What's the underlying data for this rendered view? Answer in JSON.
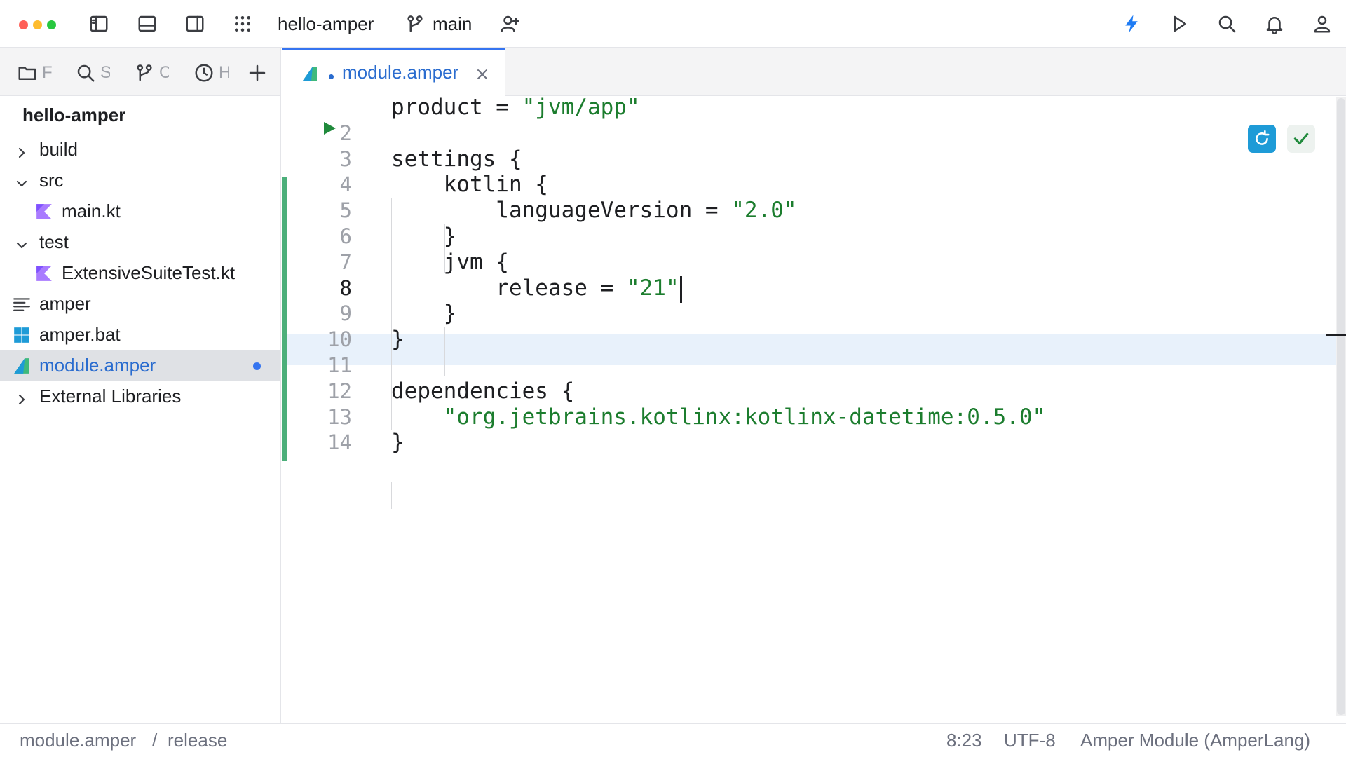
{
  "titlebar": {
    "project_name": "hello-amper",
    "branch": "main",
    "traffic_colors": [
      "#ff5f57",
      "#febc2e",
      "#28c840"
    ],
    "left_icons": [
      "sidebar-left-icon",
      "bottom-panel-icon",
      "sidebar-right-icon",
      "apps-grid-icon"
    ],
    "right_icons": [
      "lightning-icon",
      "run-icon",
      "search-icon",
      "bell-icon",
      "user-icon"
    ],
    "accent": "#1f7cf4"
  },
  "tool_tabs": [
    {
      "icon": "folder-icon",
      "label": "F"
    },
    {
      "icon": "search-icon",
      "label": "S"
    },
    {
      "icon": "git-branch-icon",
      "label": "C"
    },
    {
      "icon": "clock-icon",
      "label": "H"
    },
    {
      "icon": "plus-icon",
      "label": ""
    }
  ],
  "project_tree": {
    "title": "hello-amper",
    "items": [
      {
        "label": "build",
        "chevron": "right",
        "icon": null,
        "indent": 0
      },
      {
        "label": "src",
        "chevron": "down",
        "icon": null,
        "indent": 0
      },
      {
        "label": "main.kt",
        "chevron": null,
        "icon": "kotlin-icon",
        "indent": 1
      },
      {
        "label": "test",
        "chevron": "down",
        "icon": null,
        "indent": 0
      },
      {
        "label": "ExtensiveSuiteTest.kt",
        "chevron": null,
        "icon": "kotlin-icon",
        "indent": 1
      },
      {
        "label": "amper",
        "chevron": null,
        "icon": "text-file-icon",
        "indent": 0
      },
      {
        "label": "amper.bat",
        "chevron": null,
        "icon": "windows-icon",
        "indent": 0
      },
      {
        "label": "module.amper",
        "chevron": null,
        "icon": "amper-icon",
        "indent": 0,
        "selected": true,
        "modified": true
      },
      {
        "label": "External Libraries",
        "chevron": "right",
        "icon": null,
        "indent": 0
      }
    ]
  },
  "editor": {
    "tab_label": "module.amper",
    "tab_modified": true,
    "cursor_line": 8,
    "lines": [
      {
        "n": "",
        "parts": [
          [
            "k",
            "product = "
          ],
          [
            "s",
            "\"jvm/app\""
          ]
        ]
      },
      {
        "n": "2",
        "parts": []
      },
      {
        "n": "3",
        "parts": [
          [
            "k",
            "settings {"
          ]
        ]
      },
      {
        "n": "4",
        "parts": [
          [
            "k",
            "    kotlin {"
          ]
        ]
      },
      {
        "n": "5",
        "parts": [
          [
            "k",
            "        languageVersion = "
          ],
          [
            "s",
            "\"2.0\""
          ]
        ]
      },
      {
        "n": "6",
        "parts": [
          [
            "k",
            "    }"
          ]
        ]
      },
      {
        "n": "7",
        "parts": [
          [
            "k",
            "    jvm {"
          ]
        ]
      },
      {
        "n": "8",
        "parts": [
          [
            "k",
            "        release = "
          ],
          [
            "s",
            "\"21\""
          ]
        ]
      },
      {
        "n": "9",
        "parts": [
          [
            "k",
            "    }"
          ]
        ]
      },
      {
        "n": "10",
        "parts": [
          [
            "k",
            "}"
          ]
        ]
      },
      {
        "n": "11",
        "parts": []
      },
      {
        "n": "12",
        "parts": [
          [
            "k",
            "dependencies {"
          ]
        ]
      },
      {
        "n": "13",
        "parts": [
          [
            "s",
            "    \"org.jetbrains.kotlinx:kotlinx-datetime:0.5.0\""
          ]
        ]
      },
      {
        "n": "14",
        "parts": [
          [
            "k",
            "}"
          ]
        ]
      }
    ],
    "colors": {
      "string": "#1c7d2e",
      "change_bar": "#4caf7a",
      "sync_button": "#1e9bd7",
      "check": "#208a3c"
    }
  },
  "statusbar": {
    "breadcrumb_file": "module.amper",
    "breadcrumb_sep": "/",
    "breadcrumb_item": "release",
    "position": "8:23",
    "encoding": "UTF-8",
    "file_type": "Amper Module (AmperLang)"
  }
}
